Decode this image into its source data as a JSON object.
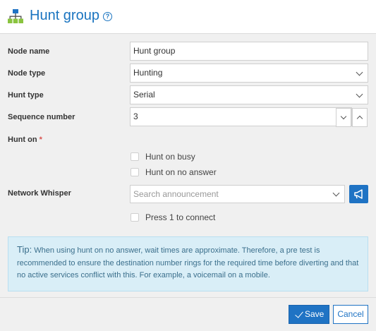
{
  "header": {
    "title": "Hunt group",
    "help_icon": "?"
  },
  "form": {
    "node_name": {
      "label": "Node name",
      "value": "Hunt group"
    },
    "node_type": {
      "label": "Node type",
      "value": "Hunting"
    },
    "hunt_type": {
      "label": "Hunt type",
      "value": "Serial"
    },
    "sequence_number": {
      "label": "Sequence number",
      "value": "3"
    },
    "hunt_on": {
      "label": "Hunt on",
      "required_mark": "*",
      "options": [
        {
          "label": "Hunt on busy",
          "checked": false
        },
        {
          "label": "Hunt on no answer",
          "checked": false
        }
      ]
    },
    "network_whisper": {
      "label": "Network Whisper",
      "placeholder": "Search announcement",
      "press1": {
        "label": "Press 1 to connect",
        "checked": false
      }
    }
  },
  "tip": {
    "heading": "Tip:",
    "text": "When using hunt on no answer, wait times are approximate. Therefore, a pre test is recommended to ensure the destination number rings for the required time before diverting and that no active services conflict with this. For example, a voicemail on a mobile."
  },
  "footer": {
    "save_label": "Save",
    "cancel_label": "Cancel"
  },
  "colors": {
    "accent": "#1f73c4",
    "tip_bg": "#d9eef7",
    "required": "#d9534f"
  },
  "icons": {
    "logo": "hunt-group-icon",
    "speaker": "megaphone-icon"
  }
}
